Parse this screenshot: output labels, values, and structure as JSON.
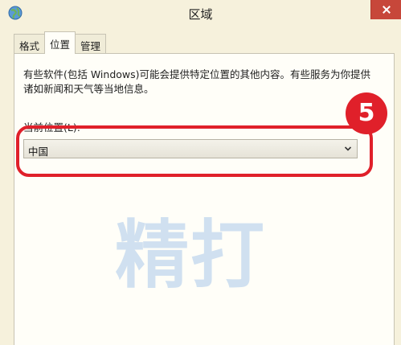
{
  "window": {
    "title": "区域",
    "app_icon": "globe-icon",
    "close_icon": "close-icon"
  },
  "tabs": [
    {
      "label": "格式",
      "active": false
    },
    {
      "label": "位置",
      "active": true
    },
    {
      "label": "管理",
      "active": false
    }
  ],
  "location_panel": {
    "description": "有些软件(包括 Windows)可能会提供特定位置的其他内容。有些服务为你提供诸如新闻和天气等当地信息。",
    "current_location_label": "当前位置(L):",
    "current_location_value": "中国"
  },
  "annotation": {
    "step_number": "5",
    "color": "#e0202a"
  },
  "watermark": {
    "text": "精打"
  }
}
